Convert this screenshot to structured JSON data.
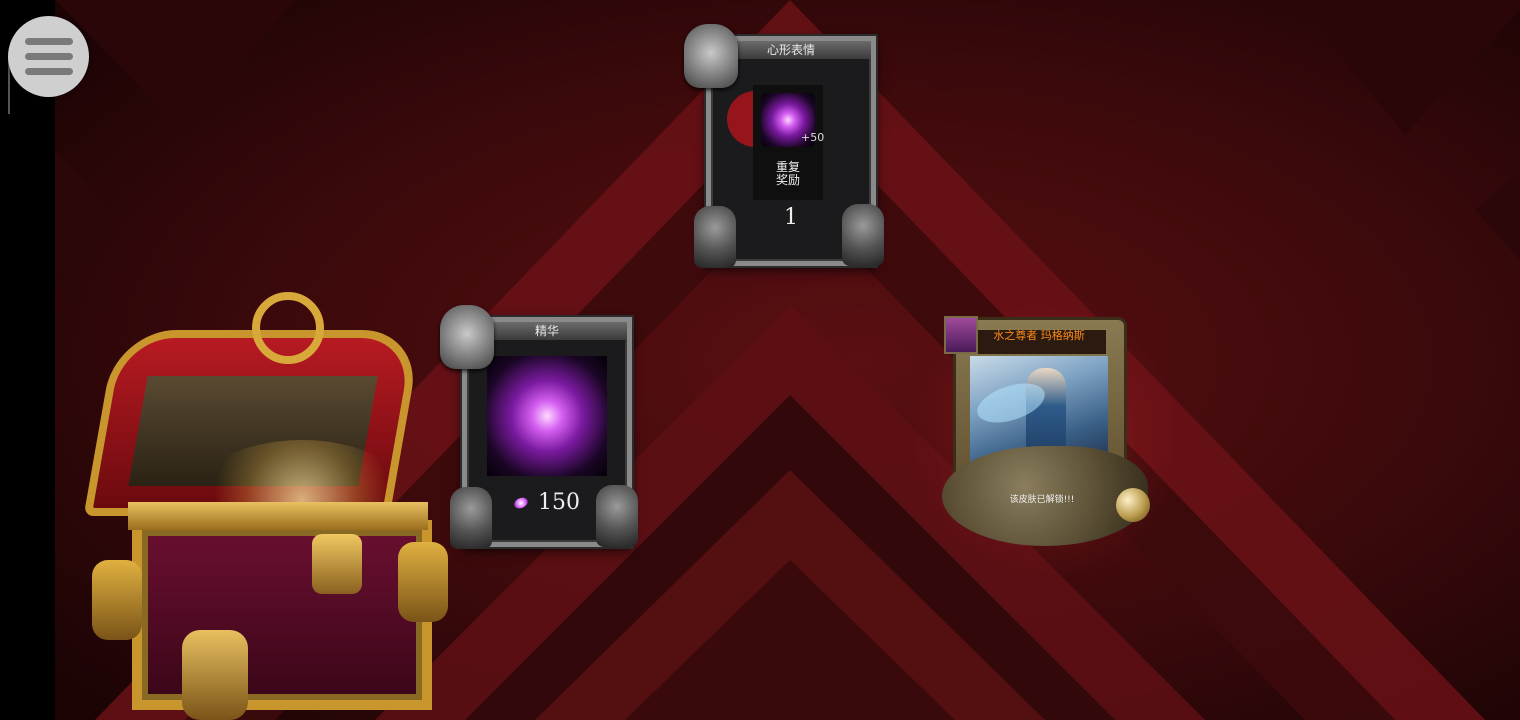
{
  "colors": {
    "bg_dark": "#2a0709",
    "bg_red": "#6e1216",
    "frame_silver": "#8a8a8a",
    "gold": "#c9962e",
    "hero_title": "#ff8a1a"
  },
  "emote_card": {
    "title": "心形表情",
    "item_bonus": "+50",
    "repeat_reward": "重复\n奖励",
    "count": "1"
  },
  "essence_card": {
    "title": "精华",
    "count": "150"
  },
  "hero_card": {
    "title": "水之尊者 玛格纳斯",
    "status": "该皮肤已解锁!!!"
  },
  "icons": {
    "menu": "hamburger-menu-icon",
    "chest": "treasure-chest-icon",
    "essence": "essence-orb-icon"
  }
}
